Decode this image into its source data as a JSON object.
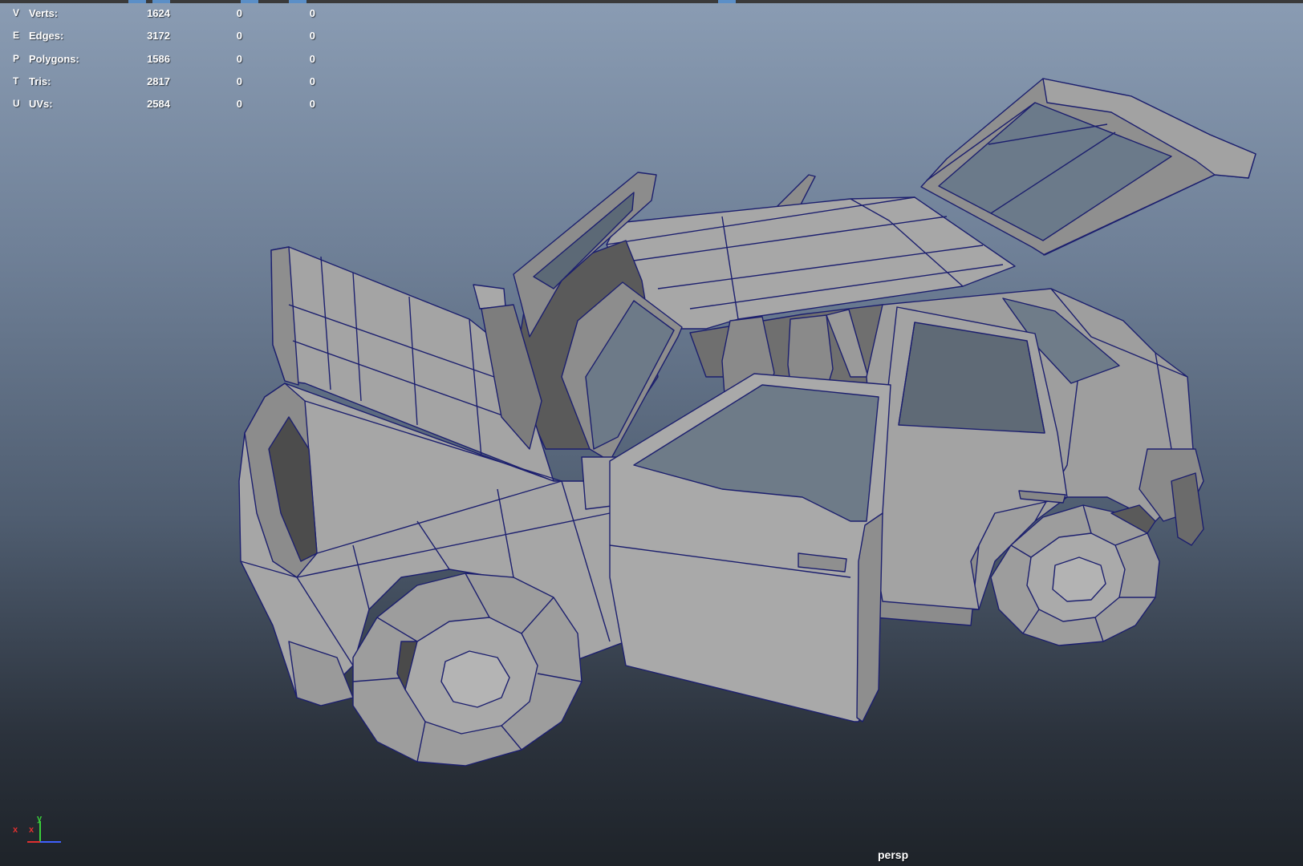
{
  "hud": {
    "rows": [
      {
        "key": "V",
        "label": "Verts:",
        "value": "1624",
        "col2": "0",
        "col3": "0"
      },
      {
        "key": "E",
        "label": "Edges:",
        "value": "3172",
        "col2": "0",
        "col3": "0"
      },
      {
        "key": "P",
        "label": "Polygons:",
        "value": "1586",
        "col2": "0",
        "col3": "0"
      },
      {
        "key": "T",
        "label": "Tris:",
        "value": "2817",
        "col2": "0",
        "col3": "0"
      },
      {
        "key": "U",
        "label": "UVs:",
        "value": "2584",
        "col2": "0",
        "col3": "0"
      }
    ]
  },
  "viewport": {
    "camera": "persp",
    "model": "low-poly car with opened hood, doors and hatch",
    "wireframe_color": "#1c1f6e",
    "shade_color": "#9a9a9a"
  },
  "axis_gizmo": {
    "x_label": "x",
    "y_label": "y",
    "z_label": "x"
  },
  "colors": {
    "background_top": "#8a9cb3",
    "background_bottom": "#1e2329",
    "hud_text": "#ffffff"
  }
}
